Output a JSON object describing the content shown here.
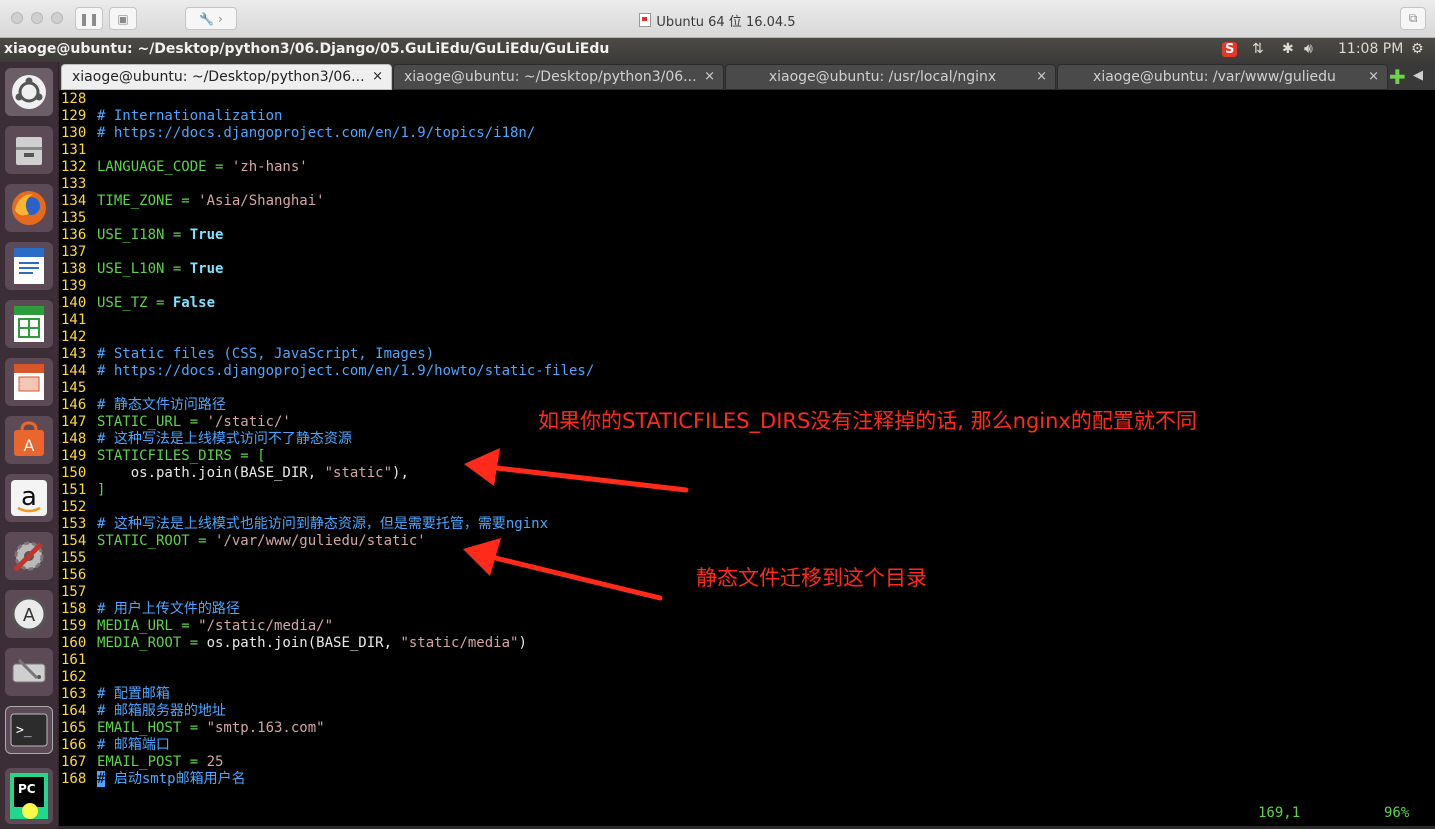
{
  "mac_window": {
    "title": "Ubuntu 64 位 16.04.5"
  },
  "ubuntu_panel": {
    "path": "xiaoge@ubuntu: ~/Desktop/python3/06.Django/05.GuLiEdu/GuLiEdu/GuLiEdu",
    "input_method": "S",
    "time": "11:08 PM"
  },
  "launcher": {
    "items": [
      "ubuntu-dash",
      "files",
      "firefox",
      "libreoffice-writer",
      "libreoffice-calc",
      "libreoffice-impress",
      "software-center",
      "amazon",
      "system-settings",
      "software-updater",
      "disks",
      "terminal",
      "pycharm"
    ]
  },
  "tabs": [
    {
      "label": "xiaoge@ubuntu: ~/Desktop/python3/06...",
      "active": true
    },
    {
      "label": "xiaoge@ubuntu: ~/Desktop/python3/06...",
      "active": false
    },
    {
      "label": "xiaoge@ubuntu: /usr/local/nginx",
      "active": false
    },
    {
      "label": "xiaoge@ubuntu: /var/www/guliedu",
      "active": false
    }
  ],
  "tab_close": "×",
  "terminal": {
    "lines": [
      {
        "n": "128",
        "parts": []
      },
      {
        "n": "129",
        "parts": [
          [
            "c-comment",
            "# Internationalization"
          ]
        ]
      },
      {
        "n": "130",
        "parts": [
          [
            "c-comment",
            "# https://docs.djangoproject.com/en/1.9/topics/i18n/"
          ]
        ]
      },
      {
        "n": "131",
        "parts": []
      },
      {
        "n": "132",
        "parts": [
          [
            "c-code",
            "LANGUAGE_CODE = "
          ],
          [
            "c-str",
            "'zh-hans'"
          ]
        ]
      },
      {
        "n": "133",
        "parts": []
      },
      {
        "n": "134",
        "parts": [
          [
            "c-code",
            "TIME_ZONE = "
          ],
          [
            "c-str",
            "'Asia/Shanghai'"
          ]
        ]
      },
      {
        "n": "135",
        "parts": []
      },
      {
        "n": "136",
        "parts": [
          [
            "c-code",
            "USE_I18N = "
          ],
          [
            "c-kw",
            "True"
          ]
        ]
      },
      {
        "n": "137",
        "parts": []
      },
      {
        "n": "138",
        "parts": [
          [
            "c-code",
            "USE_L10N = "
          ],
          [
            "c-kw",
            "True"
          ]
        ]
      },
      {
        "n": "139",
        "parts": []
      },
      {
        "n": "140",
        "parts": [
          [
            "c-code",
            "USE_TZ = "
          ],
          [
            "c-kw",
            "False"
          ]
        ]
      },
      {
        "n": "141",
        "parts": []
      },
      {
        "n": "142",
        "parts": []
      },
      {
        "n": "143",
        "parts": [
          [
            "c-comment",
            "# Static files (CSS, JavaScript, Images)"
          ]
        ]
      },
      {
        "n": "144",
        "parts": [
          [
            "c-comment",
            "# https://docs.djangoproject.com/en/1.9/howto/static-files/"
          ]
        ]
      },
      {
        "n": "145",
        "parts": []
      },
      {
        "n": "146",
        "parts": [
          [
            "c-comment",
            "# 静态文件访问路径"
          ]
        ]
      },
      {
        "n": "147",
        "parts": [
          [
            "c-code",
            "STATIC_URL = "
          ],
          [
            "c-str",
            "'/static/'"
          ]
        ]
      },
      {
        "n": "148",
        "parts": [
          [
            "c-comment",
            "# 这种写法是上线模式访问不了静态资源"
          ]
        ]
      },
      {
        "n": "149",
        "parts": [
          [
            "c-code",
            "STATICFILES_DIRS = ["
          ]
        ]
      },
      {
        "n": "150",
        "parts": [
          [
            "c-plain",
            "    os.path.join(BASE_DIR, "
          ],
          [
            "c-str",
            "\"static\""
          ],
          [
            "c-plain",
            "),"
          ]
        ]
      },
      {
        "n": "151",
        "parts": [
          [
            "c-code",
            "]"
          ]
        ]
      },
      {
        "n": "152",
        "parts": []
      },
      {
        "n": "153",
        "parts": [
          [
            "c-comment",
            "# 这种写法是上线模式也能访问到静态资源，但是需要托管，需要nginx"
          ]
        ]
      },
      {
        "n": "154",
        "parts": [
          [
            "c-code",
            "STATIC_ROOT = "
          ],
          [
            "c-str",
            "'/var/www/guliedu/static'"
          ]
        ]
      },
      {
        "n": "155",
        "parts": []
      },
      {
        "n": "156",
        "parts": []
      },
      {
        "n": "157",
        "parts": []
      },
      {
        "n": "158",
        "parts": [
          [
            "c-comment",
            "# 用户上传文件的路径"
          ]
        ]
      },
      {
        "n": "159",
        "parts": [
          [
            "c-code",
            "MEDIA_URL = "
          ],
          [
            "c-str",
            "\"/static/media/\""
          ]
        ]
      },
      {
        "n": "160",
        "parts": [
          [
            "c-code",
            "MEDIA_ROOT = "
          ],
          [
            "c-plain",
            "os.path.join(BASE_DIR, "
          ],
          [
            "c-str",
            "\"static/media\""
          ],
          [
            "c-plain",
            ")"
          ]
        ]
      },
      {
        "n": "161",
        "parts": []
      },
      {
        "n": "162",
        "parts": []
      },
      {
        "n": "163",
        "parts": [
          [
            "c-comment",
            "# 配置邮箱"
          ]
        ]
      },
      {
        "n": "164",
        "parts": [
          [
            "c-comment",
            "# 邮箱服务器的地址"
          ]
        ]
      },
      {
        "n": "165",
        "parts": [
          [
            "c-code",
            "EMAIL_HOST = "
          ],
          [
            "c-str",
            "\"smtp.163.com\""
          ]
        ]
      },
      {
        "n": "166",
        "parts": [
          [
            "c-comment",
            "# 邮箱端口"
          ]
        ]
      },
      {
        "n": "167",
        "parts": [
          [
            "c-code",
            "EMAIL_POST = "
          ],
          [
            "c-str",
            "25"
          ]
        ]
      },
      {
        "n": "168",
        "parts": [
          [
            "cursor",
            "#"
          ],
          [
            "c-comment",
            " 启动smtp邮箱用户名"
          ]
        ]
      }
    ],
    "status_position": "169,1",
    "status_percent": "96%"
  },
  "annotations": {
    "note1": "如果你的STATICFILES_DIRS没有注释掉的话, 那么nginx的配置就不同",
    "note2": "静态文件迁移到这个目录",
    "arrow_color": "#ff2a1a"
  }
}
